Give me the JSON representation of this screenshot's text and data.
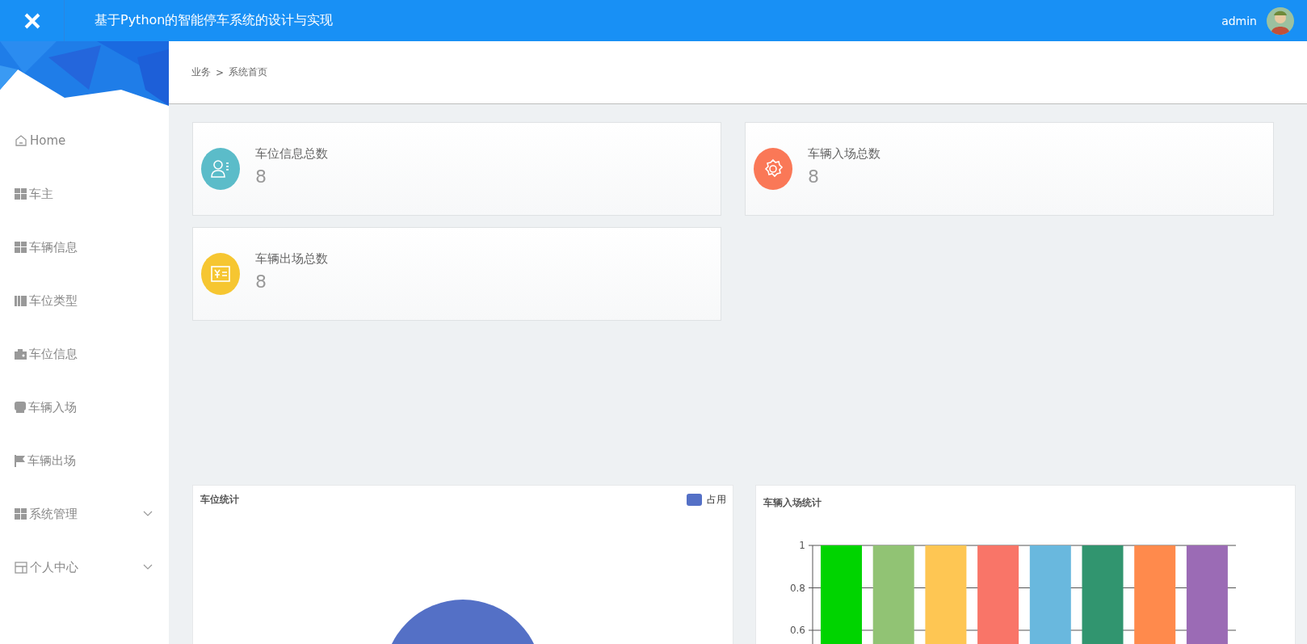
{
  "header": {
    "title": "基于Python的智能停车系统的设计与实现",
    "user": "admin"
  },
  "sidebar": {
    "items": [
      {
        "label": "Home",
        "kind": "link"
      },
      {
        "label": "车主",
        "kind": "link"
      },
      {
        "label": "车辆信息",
        "kind": "link"
      },
      {
        "label": "车位类型",
        "kind": "link"
      },
      {
        "label": "车位信息",
        "kind": "link"
      },
      {
        "label": "车辆入场",
        "kind": "link"
      },
      {
        "label": "车辆出场",
        "kind": "link"
      },
      {
        "label": "系统管理",
        "kind": "group",
        "expanded": false
      },
      {
        "label": "个人中心",
        "kind": "group",
        "expanded": false
      }
    ]
  },
  "breadcrumb": {
    "items": [
      "业务",
      "系统首页"
    ],
    "separator": ">"
  },
  "stats": [
    {
      "title": "车位信息总数",
      "value": "8",
      "color": "#5bbcc9"
    },
    {
      "title": "车辆入场总数",
      "value": "8",
      "color": "#fa7857"
    },
    {
      "title": "车辆出场总数",
      "value": "8",
      "color": "#f6c631"
    }
  ],
  "charts": [
    {
      "title": "车位统计",
      "kind": "pie",
      "legend": [
        {
          "label": "占用",
          "color": "#5470c6"
        }
      ]
    },
    {
      "title": "车辆入场统计",
      "chart_data": {
        "type": "bar",
        "values": [
          1,
          1,
          1,
          1,
          1,
          1,
          1,
          1
        ],
        "colors": [
          "#00d400",
          "#91c374",
          "#fec653",
          "#f97568",
          "#69b8de",
          "#31956f",
          "#ff8a4c",
          "#9b6bb5"
        ],
        "ylim": [
          0,
          1
        ],
        "yticks": [
          0.6,
          0.8,
          1
        ]
      }
    }
  ]
}
